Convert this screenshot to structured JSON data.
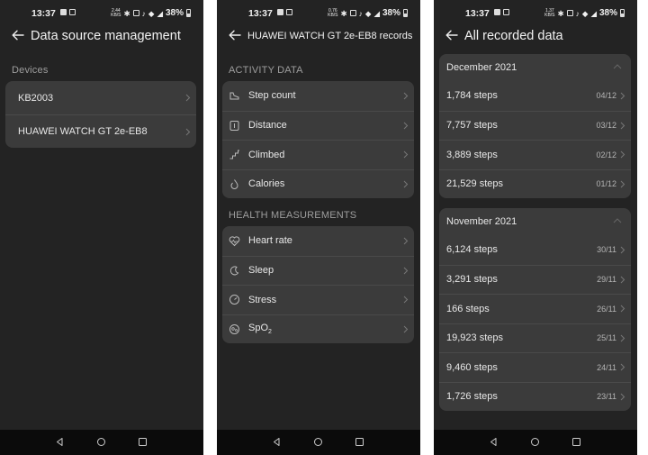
{
  "status": {
    "time": "13:37",
    "battery": "38%",
    "speed1_top": "2.44",
    "speed1_bot": "KB/S",
    "speed2_top": "0.76",
    "speed2_bot": "KB/S",
    "speed3_top": "1.37",
    "speed3_bot": "KB/S"
  },
  "screen1": {
    "title": "Data source management",
    "section": "Devices",
    "devices": [
      {
        "label": "KB2003"
      },
      {
        "label": "HUAWEI WATCH GT 2e-EB8"
      }
    ]
  },
  "screen2": {
    "title": "HUAWEI WATCH GT 2e-EB8 records",
    "activity_section": "ACTIVITY DATA",
    "activity": [
      {
        "label": "Step count",
        "icon": "shoe-icon"
      },
      {
        "label": "Distance",
        "icon": "distance-icon"
      },
      {
        "label": "Climbed",
        "icon": "stairs-icon"
      },
      {
        "label": "Calories",
        "icon": "flame-icon"
      }
    ],
    "health_section": "HEALTH MEASUREMENTS",
    "health": [
      {
        "label": "Heart rate",
        "icon": "heart-pulse-icon"
      },
      {
        "label": "Sleep",
        "icon": "sleep-icon"
      },
      {
        "label": "Stress",
        "icon": "gauge-icon"
      },
      {
        "label": "SpO",
        "sub": "2",
        "icon": "oxygen-icon"
      }
    ]
  },
  "screen3": {
    "title": "All recorded data",
    "groups": [
      {
        "month": "December 2021",
        "rows": [
          {
            "steps": "1,784 steps",
            "date": "04/12"
          },
          {
            "steps": "7,757 steps",
            "date": "03/12"
          },
          {
            "steps": "3,889 steps",
            "date": "02/12"
          },
          {
            "steps": "21,529 steps",
            "date": "01/12"
          }
        ]
      },
      {
        "month": "November 2021",
        "rows": [
          {
            "steps": "6,124 steps",
            "date": "30/11"
          },
          {
            "steps": "3,291 steps",
            "date": "29/11"
          },
          {
            "steps": "166 steps",
            "date": "26/11"
          },
          {
            "steps": "19,923 steps",
            "date": "25/11"
          },
          {
            "steps": "9,460 steps",
            "date": "24/11"
          },
          {
            "steps": "1,726 steps",
            "date": "23/11"
          }
        ]
      }
    ]
  }
}
